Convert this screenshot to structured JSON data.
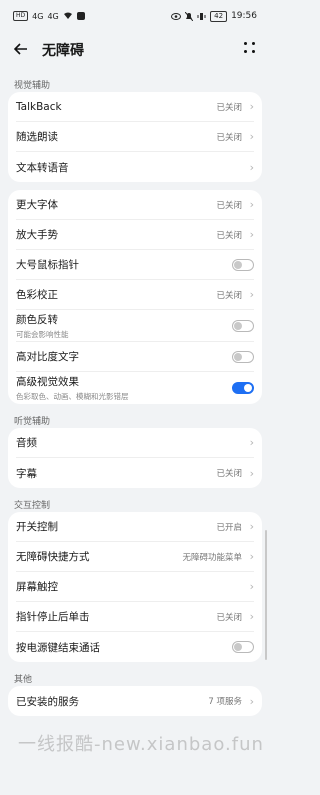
{
  "status": {
    "left_icons": [
      "HD",
      "4G",
      "4G",
      "wifi",
      "app"
    ],
    "right_icons": [
      "eye",
      "bell-off",
      "vibrate",
      "battery"
    ],
    "battery": "42",
    "time": "19:56"
  },
  "header": {
    "title": "无障碍"
  },
  "sections": {
    "vision": "视觉辅助",
    "hearing": "听觉辅助",
    "interaction": "交互控制",
    "other": "其他"
  },
  "vision_a": [
    {
      "label": "TalkBack",
      "value": "已关闭"
    },
    {
      "label": "随选朗读",
      "value": "已关闭"
    },
    {
      "label": "文本转语音",
      "value": ""
    }
  ],
  "vision_b": [
    {
      "label": "更大字体",
      "value": "已关闭"
    },
    {
      "label": "放大手势",
      "value": "已关闭"
    },
    {
      "label": "大号鼠标指针",
      "toggle": false
    },
    {
      "label": "色彩校正",
      "value": "已关闭"
    },
    {
      "label": "颜色反转",
      "sub": "可能会影响性能",
      "toggle": false
    },
    {
      "label": "高对比度文字",
      "toggle": false
    },
    {
      "label": "高级视觉效果",
      "sub": "色彩取色、动画、模糊和光影错层",
      "toggle": true
    }
  ],
  "hearing": [
    {
      "label": "音频",
      "value": ""
    },
    {
      "label": "字幕",
      "value": "已关闭"
    }
  ],
  "interaction": [
    {
      "label": "开关控制",
      "value": "已开启"
    },
    {
      "label": "无障碍快捷方式",
      "value": "无障碍功能菜单"
    },
    {
      "label": "屏幕触控",
      "value": ""
    },
    {
      "label": "指针停止后单击",
      "value": "已关闭"
    },
    {
      "label": "按电源键结束通话",
      "toggle": false
    }
  ],
  "other": [
    {
      "label": "已安装的服务",
      "value": "7 项服务"
    }
  ],
  "watermark": "一线报酷-new.xianbao.fun"
}
